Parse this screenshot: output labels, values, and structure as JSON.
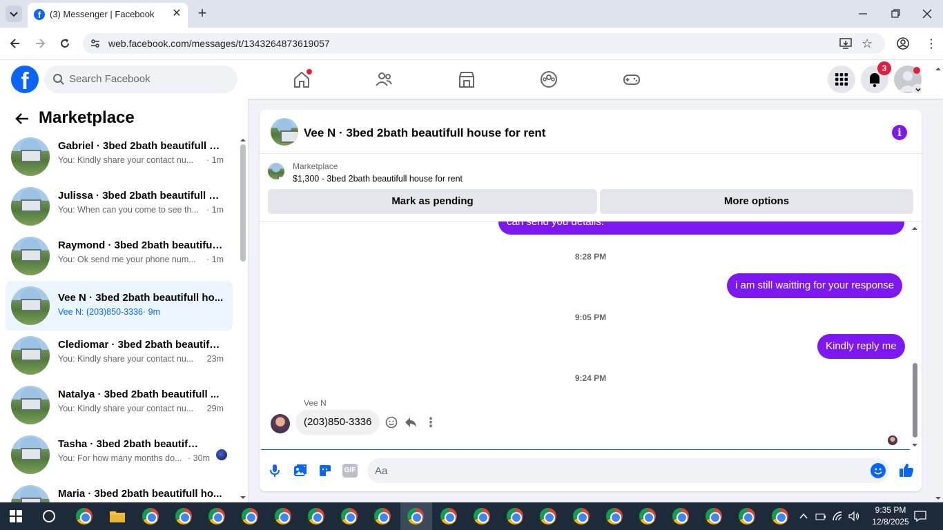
{
  "browser": {
    "tab_title": "(3) Messenger | Facebook",
    "url": "web.facebook.com/messages/t/1343264873619057"
  },
  "header": {
    "search_placeholder": "Search Facebook",
    "notification_count": "3",
    "colors": {
      "brand": "#0866ff",
      "badge": "#e41e3f"
    }
  },
  "sidebar": {
    "title": "Marketplace",
    "conversations": [
      {
        "title": "Gabriel · 3bed 2bath beautifull h...",
        "preview": "You: Kindly share your contact nu...",
        "time": "· 1m"
      },
      {
        "title": "Julissa · 3bed 2bath beautifull h...",
        "preview": "You: When can you come to see th...",
        "time": "· 1m"
      },
      {
        "title": "Raymond · 3bed 2bath beautifull...",
        "preview": "You: Ok send me your phone num...",
        "time": "· 1m"
      },
      {
        "title": "Vee N · 3bed 2bath beautifull ho...",
        "preview": "Vee N: (203)850-3336",
        "time": "· 9m"
      },
      {
        "title": "Clediomar · 3bed 2bath beautifu...",
        "preview": "You: Kindly share your contact nu...",
        "time": "23m"
      },
      {
        "title": "Natalya · 3bed 2bath beautifull ...",
        "preview": "You: Kindly share your contact nu...",
        "time": "29m"
      },
      {
        "title": "Tasha · 3bed 2bath beautifull ...",
        "preview": "You: For how many months do...",
        "time": "· 30m"
      },
      {
        "title": "Maria · 3bed 2bath beautifull ho...",
        "preview": "",
        "time": ""
      }
    ]
  },
  "chat": {
    "title": "Vee N · 3bed 2bath beautifull house for rent",
    "listing_label": "Marketplace",
    "listing_desc": "$1,300 - 3bed 2bath beautifull house for rent",
    "mark_pending": "Mark as pending",
    "more_options": "More options",
    "cutoff_message": "can send you  details.",
    "ts1": "8:28 PM",
    "msg1": "i am still waitting for your response",
    "ts2": "9:05 PM",
    "msg2": "Kindly reply me",
    "ts3": "9:24 PM",
    "sender": "Vee N",
    "incoming": "(203)850-3336",
    "composer_placeholder": "Aa",
    "accent": "#7d18f2"
  },
  "taskbar": {
    "time": "9:35 PM",
    "date": "12/8/2025"
  }
}
